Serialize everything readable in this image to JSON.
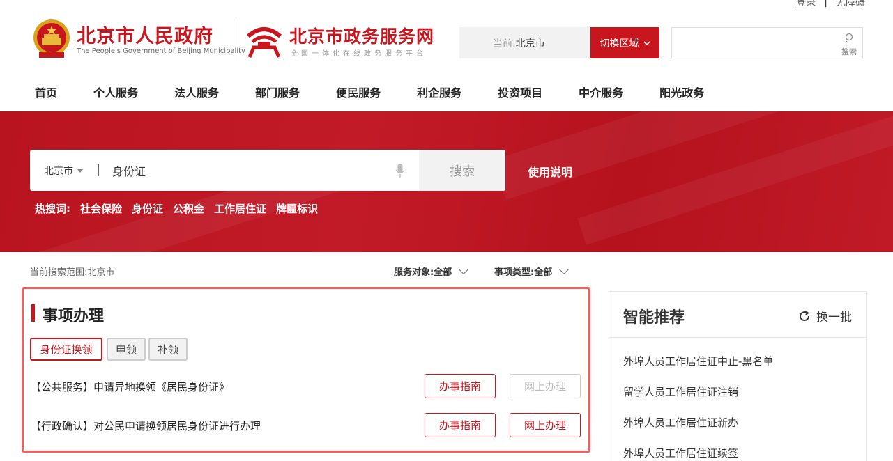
{
  "top_links": {
    "login": "登录",
    "separator": "|",
    "accessibility": "无障碍"
  },
  "header": {
    "gov_title": "北京市人民政府",
    "gov_subtitle": "The People's Government of Beijing Municipality",
    "zw_title": "北京市政务服务网",
    "zw_subtitle": "全国一体化在线政务服务平台",
    "region_label": "当前:",
    "region_value": "北京市",
    "switch_label": "切换区域",
    "search_label": "搜索"
  },
  "nav": [
    "首页",
    "个人服务",
    "法人服务",
    "部门服务",
    "便民服务",
    "利企服务",
    "投资项目",
    "中介服务",
    "阳光政务"
  ],
  "search": {
    "city": "北京市",
    "query": "身份证",
    "button": "搜索",
    "usage_link": "使用说明",
    "hot_label": "热搜词:",
    "hot_words": [
      "社会保险",
      "身份证",
      "公积金",
      "工作居住证",
      "牌匾标识"
    ]
  },
  "filters": {
    "scope": "当前搜索范围:北京市",
    "service_target": "服务对象:全部",
    "item_type": "事项类型:全部"
  },
  "matters": {
    "title": "事项办理",
    "tags": [
      "身份证换领",
      "申领",
      "补领"
    ],
    "rows": [
      {
        "text": "【公共服务】申请异地换领《居民身份证》",
        "guide": "办事指南",
        "online": "网上办理",
        "online_enabled": false
      },
      {
        "text": "【行政确认】对公民申请换领居民身份证进行办理",
        "guide": "办事指南",
        "online": "网上办理",
        "online_enabled": true
      }
    ]
  },
  "recommend": {
    "title": "智能推荐",
    "refresh": "换一批",
    "items": [
      "外埠人员工作居住证中止-黑名单",
      "留学人员工作居住证注销",
      "外埠人员工作居住证新办",
      "外埠人员工作居住证续签"
    ]
  },
  "colors": {
    "brand_red": "#c8161e",
    "panel_border": "#f06060"
  }
}
